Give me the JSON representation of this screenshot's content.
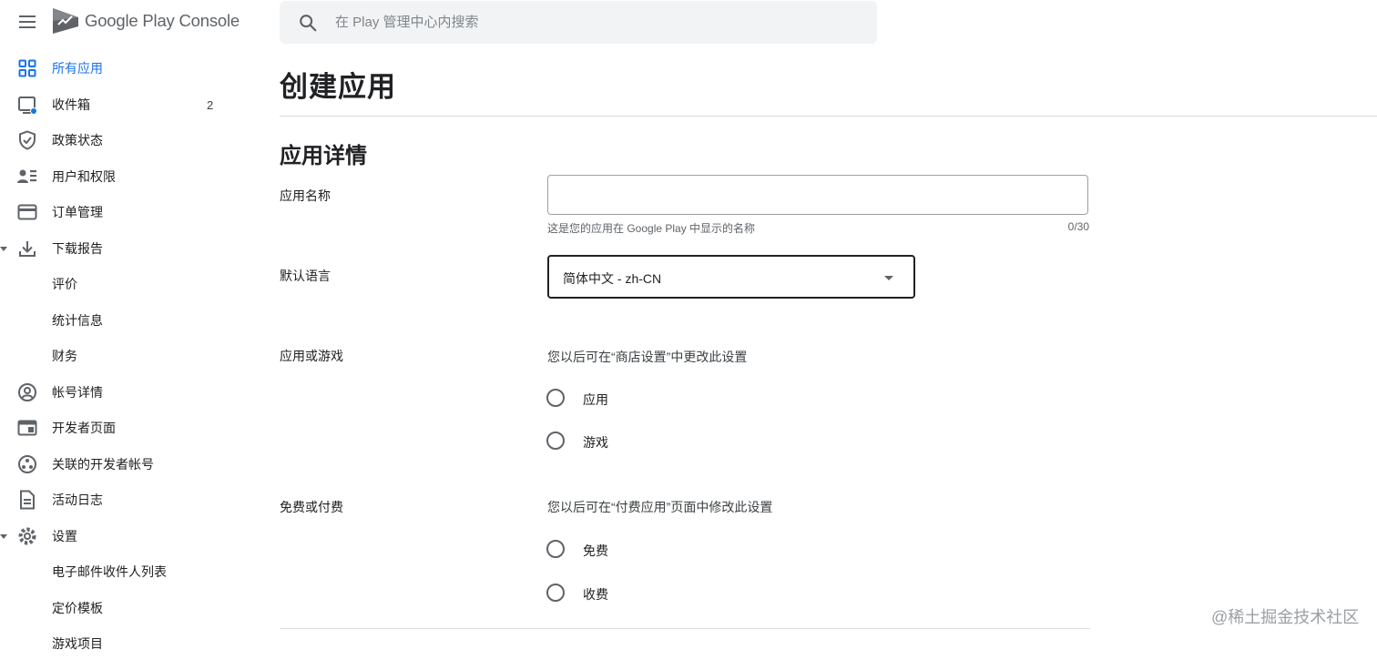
{
  "header": {
    "brand": "Google Play Console",
    "search_placeholder": "在 Play 管理中心内搜索"
  },
  "sidebar": {
    "items": [
      {
        "label": "所有应用",
        "icon": "grid-icon",
        "active": true
      },
      {
        "label": "收件箱",
        "icon": "inbox-icon",
        "badge": "2"
      },
      {
        "label": "政策状态",
        "icon": "shield-icon"
      },
      {
        "label": "用户和权限",
        "icon": "users-icon"
      },
      {
        "label": "订单管理",
        "icon": "credit-card-icon"
      },
      {
        "label": "下载报告",
        "icon": "download-icon",
        "expanded": true
      },
      {
        "label": "评价"
      },
      {
        "label": "统计信息"
      },
      {
        "label": "财务"
      },
      {
        "label": "帐号详情",
        "icon": "account-circle-icon"
      },
      {
        "label": "开发者页面",
        "icon": "web-page-icon"
      },
      {
        "label": "关联的开发者帐号",
        "icon": "linked-accounts-icon"
      },
      {
        "label": "活动日志",
        "icon": "document-icon"
      },
      {
        "label": "设置",
        "icon": "gear-icon",
        "expanded": true
      },
      {
        "label": "电子邮件收件人列表"
      },
      {
        "label": "定价模板"
      },
      {
        "label": "游戏项目"
      }
    ]
  },
  "main": {
    "page_title": "创建应用",
    "section_title": "应用详情",
    "app_name": {
      "label": "应用名称",
      "value": "",
      "hint": "这是您的应用在 Google Play 中显示的名称",
      "counter": "0/30"
    },
    "default_language": {
      "label": "默认语言",
      "value": "简体中文 - zh-CN"
    },
    "app_or_game": {
      "label": "应用或游戏",
      "description": "您以后可在“商店设置”中更改此设置",
      "options": [
        "应用",
        "游戏"
      ]
    },
    "free_or_paid": {
      "label": "免费或付费",
      "description": "您以后可在“付费应用”页面中修改此设置",
      "options": [
        "免费",
        "收费"
      ]
    }
  },
  "watermark": "@稀土掘金技术社区",
  "colors": {
    "accent": "#1a73e8",
    "text": "#202124",
    "secondary_text": "#5f6368",
    "search_bg": "#f1f3f4",
    "divider": "#dadce0"
  }
}
